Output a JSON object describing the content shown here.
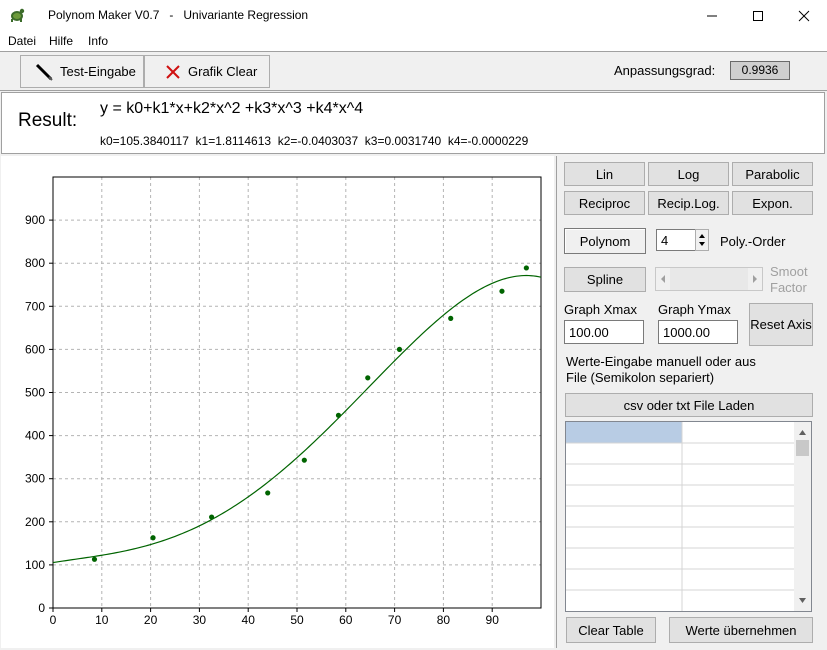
{
  "window": {
    "title": "Polynom Maker V0.7   -   Univariante Regression",
    "icon": "turtle-app-icon"
  },
  "menu": [
    "Datei",
    "Hilfe",
    "Info"
  ],
  "toolbar": {
    "test_input": "Test-Eingabe",
    "clear_graph": "Grafik Clear",
    "fit_label": "Anpassungsgrad:",
    "fit_value": "0.9936"
  },
  "result": {
    "label": "Result:",
    "equation": "y = k0+k1*x+k2*x^2 +k3*x^3 +k4*x^4",
    "coefficients": "k0=105.3840117  k1=1.8114613  k2=-0.0403037  k3=0.0031740  k4=-0.0000229"
  },
  "buttons": {
    "lin": "Lin",
    "log": "Log",
    "parabolic": "Parabolic",
    "reciproc": "Reciproc",
    "recip_log": "Recip.Log.",
    "expon": "Expon.",
    "polynom": "Polynom",
    "spline": "Spline",
    "reset_axis": "Reset Axis",
    "load_file": "csv oder txt File Laden",
    "clear_table": "Clear Table",
    "apply_values": "Werte übernehmen"
  },
  "poly_order": {
    "value": "4",
    "label": "Poly.-Order"
  },
  "smooth": {
    "label": "Smoot Factor"
  },
  "graph_x": {
    "label": "Graph Xmax",
    "value": "100.00"
  },
  "graph_y": {
    "label": "Graph Ymax",
    "value": "1000.00"
  },
  "input_hint": "Werte-Eingabe manuell oder aus File (Semikolon separiert)",
  "colors": {
    "accent_cell": "#b8cce4",
    "curve": "#006400",
    "points": "#006400"
  },
  "chart_data": {
    "type": "scatter",
    "xlim": [
      0,
      100
    ],
    "ylim": [
      0,
      1000
    ],
    "xticks": [
      0,
      10,
      20,
      30,
      40,
      50,
      60,
      70,
      80,
      90
    ],
    "yticks": [
      0,
      100,
      200,
      300,
      400,
      500,
      600,
      700,
      800,
      900
    ],
    "grid": true,
    "points": {
      "x": [
        8.5,
        20.5,
        32.5,
        44,
        51.5,
        58.5,
        64.5,
        71,
        81.5,
        92,
        97
      ],
      "y": [
        113,
        163,
        211,
        267,
        343,
        447,
        534,
        600,
        672,
        735,
        789
      ]
    },
    "fit": {
      "kind": "polynomial",
      "coefficients": [
        105.3840117,
        1.8114613,
        -0.0403037,
        0.003174,
        -2.29e-05
      ],
      "x_range": [
        0,
        100
      ]
    }
  }
}
